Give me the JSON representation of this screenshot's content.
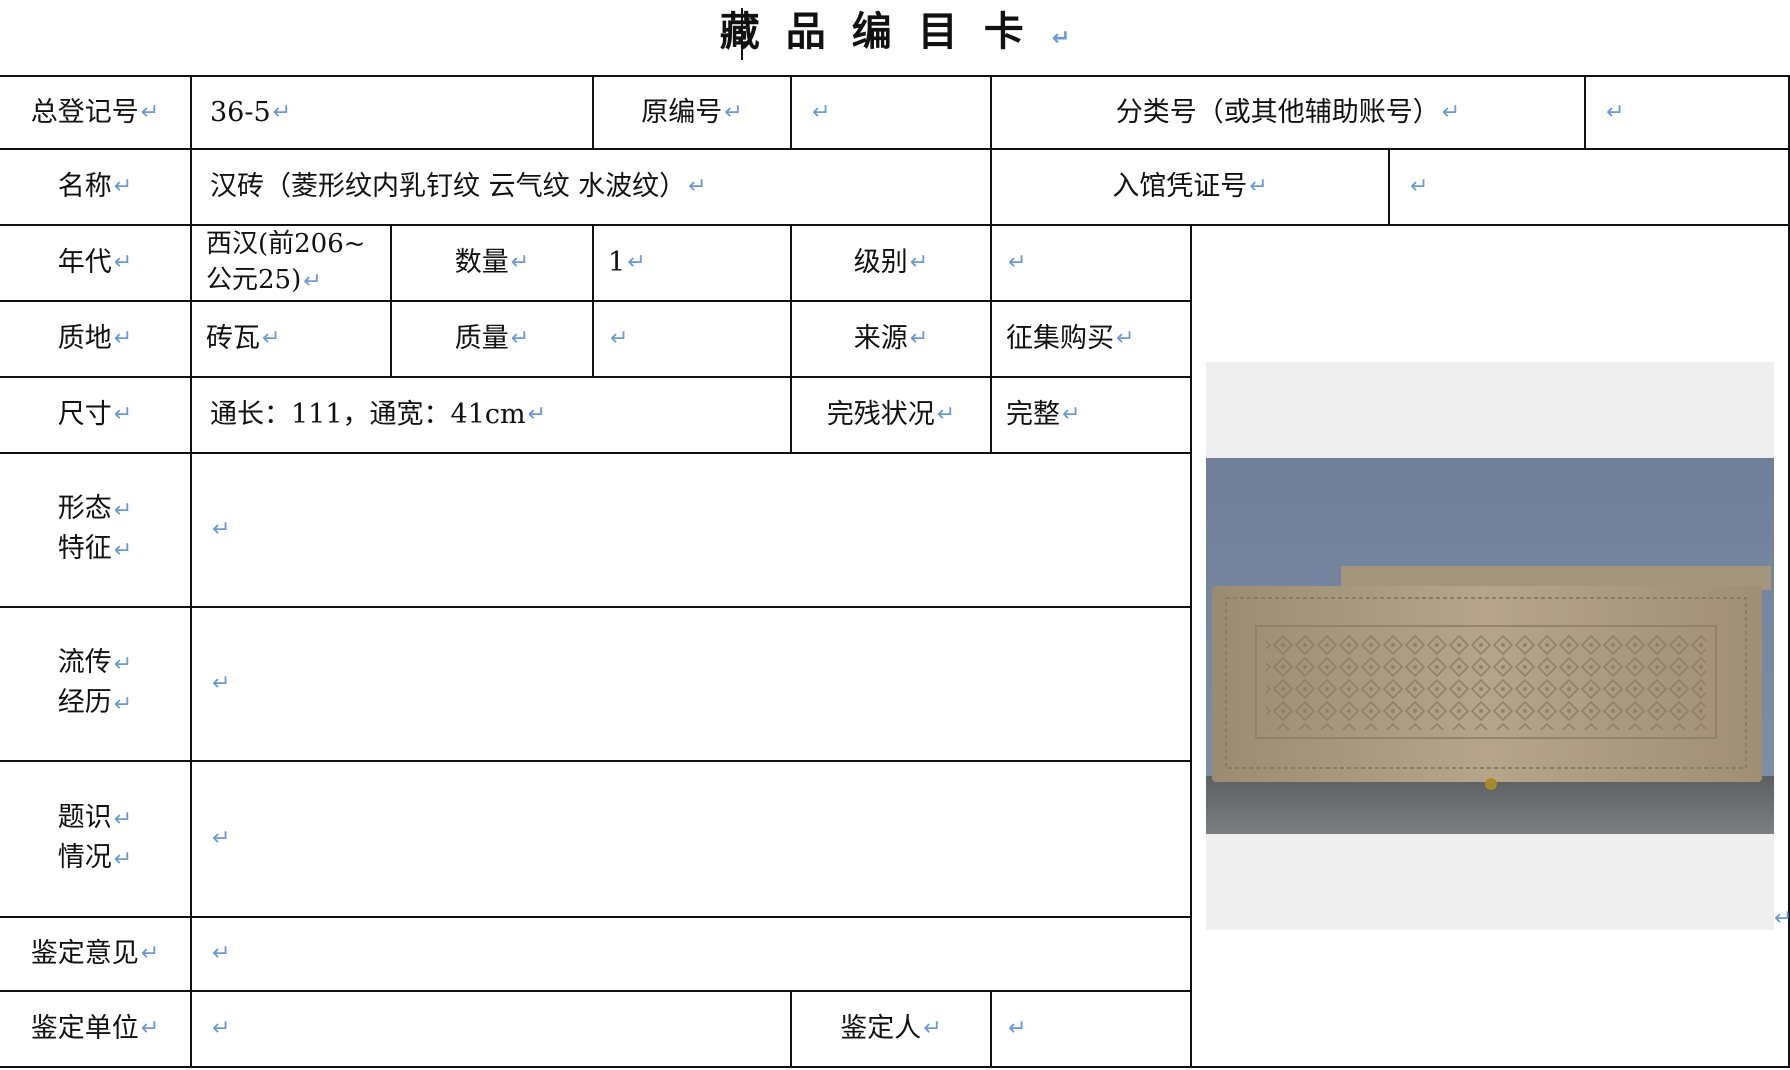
{
  "title": "藏品编目卡",
  "return_mark": "↵",
  "colors": {
    "line": "#111111",
    "return_mark": "#6b9ad8",
    "photo_bg": "#efefef"
  },
  "rows": {
    "registration_label": "总登记号",
    "registration_value": "36-5",
    "original_no_label": "原编号",
    "original_no_value": "",
    "classification_label": "分类号（或其他辅助账号）",
    "classification_value": "",
    "name_label": "名称",
    "name_value": "汉砖（菱形纹内乳钉纹 云气纹 水波纹）",
    "voucher_label": "入馆凭证号",
    "voucher_value": "",
    "era_label": "年代",
    "era_value_line1": "西汉(前206~",
    "era_value_line2": "公元25)",
    "quantity_label": "数量",
    "quantity_value": "1",
    "grade_label": "级别",
    "grade_value": "",
    "material_label": "质地",
    "material_value": "砖瓦",
    "weight_label": "质量",
    "weight_value": "",
    "source_label": "来源",
    "source_value": "征集购买",
    "size_label": "尺寸",
    "size_value": "通长：111，通宽：41cm",
    "condition_label": "完残状况",
    "condition_value": "完整",
    "form_label_1": "形态",
    "form_label_2": "特征",
    "form_value": "",
    "history_label_1": "流传",
    "history_label_2": "经历",
    "history_value": "",
    "inscription_label_1": "题识",
    "inscription_label_2": "情况",
    "inscription_value": "",
    "opinion_label": "鉴定意见",
    "opinion_value": "",
    "unit_label": "鉴定单位",
    "unit_value": "",
    "appraiser_label": "鉴定人",
    "appraiser_value": ""
  },
  "photo": {
    "subject": "han-brick-photo"
  }
}
